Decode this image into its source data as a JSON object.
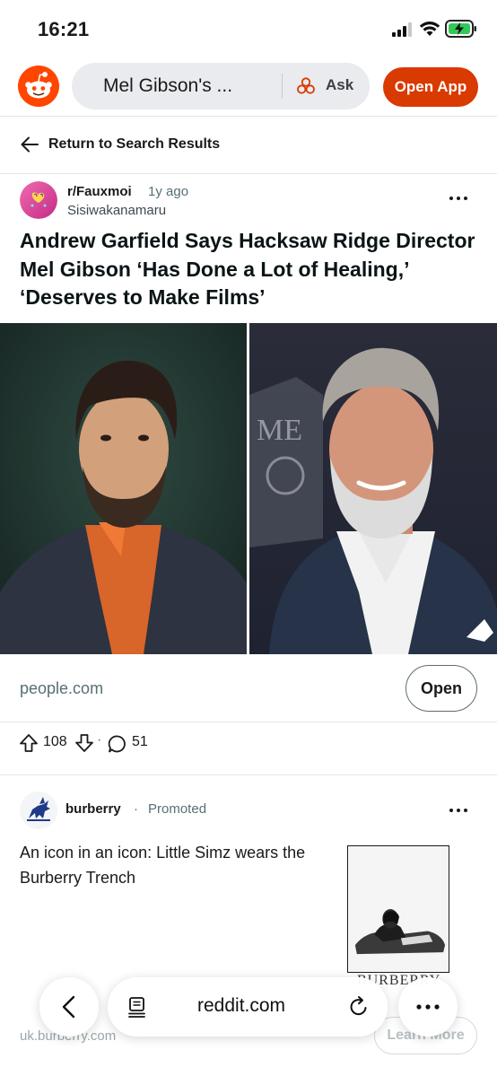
{
  "status_bar": {
    "time": "16:21"
  },
  "header": {
    "search_query": "Mel Gibson's ...",
    "ask_label": "Ask",
    "open_app_label": "Open App"
  },
  "return_row": {
    "label": "Return to Search Results"
  },
  "post": {
    "subreddit": "r/Fauxmoi",
    "age": "1y ago",
    "author": "Sisiwakanamaru",
    "title": "Andrew Garfield Says Hacksaw Ridge Director Mel Gibson ‘Has Done a Lot of Healing,’ ‘Deserves to Make Films’",
    "link_domain": "people.com",
    "open_label": "Open",
    "upvotes": "108",
    "dot": "·",
    "comments": "51"
  },
  "promoted": {
    "advertiser": "burberry",
    "dot": "·",
    "label": "Promoted",
    "text": "An icon in an icon: Little Simz wears the Burberry Trench",
    "thumb_brand": "BURBERRY",
    "domain": "uk.burberry.com",
    "cta_label": "Learn More"
  },
  "browser_toolbar": {
    "url": "reddit.com"
  },
  "colors": {
    "accent": "#d93a00",
    "reddit_orange": "#ff4500",
    "muted_text": "#576f76"
  },
  "icons": [
    "reddit-logo-icon",
    "ask-icon",
    "back-arrow-icon",
    "more-icon",
    "upvote-icon",
    "downvote-icon",
    "comment-icon",
    "reader-icon",
    "reload-icon"
  ]
}
